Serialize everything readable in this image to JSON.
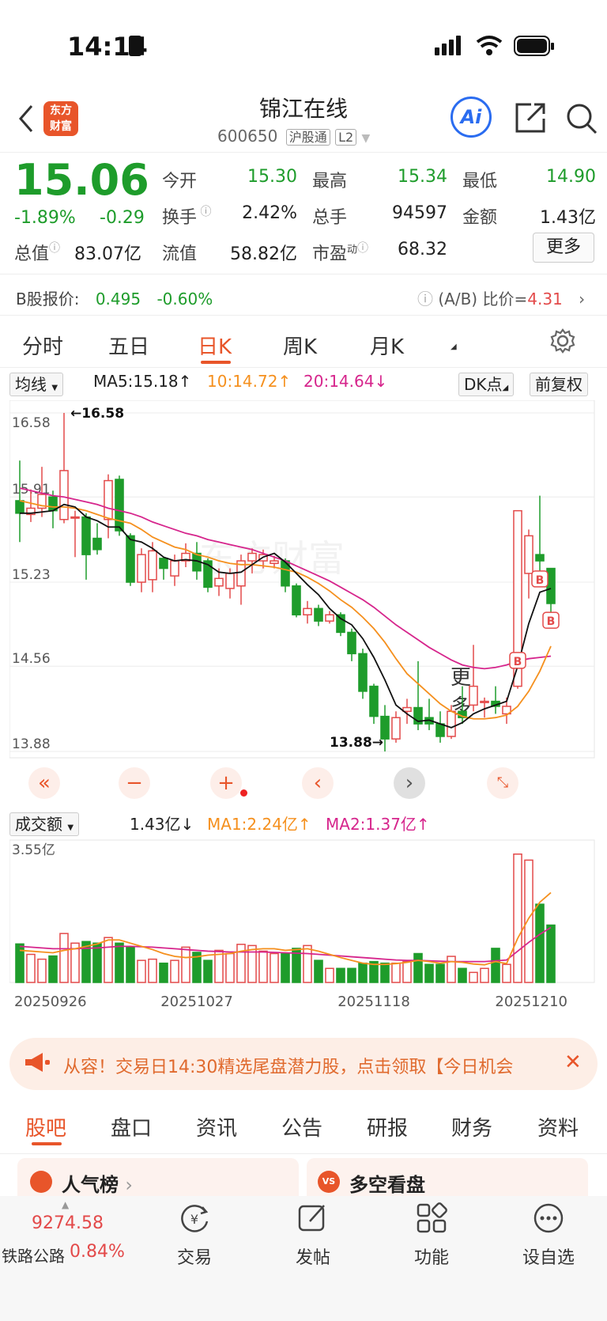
{
  "status": {
    "time": "14:14"
  },
  "header": {
    "logo_text": "东方财富",
    "name": "锦江在线",
    "code": "600650",
    "tag1": "沪股通",
    "tag2": "L2",
    "ai_label": "Ai"
  },
  "quote": {
    "price": "15.06",
    "change_pct": "-1.89%",
    "change_abs": "-0.29",
    "rows": [
      [
        {
          "label": "今开",
          "value": "15.30",
          "color": "green"
        },
        {
          "label": "最高",
          "value": "15.34",
          "color": "green"
        },
        {
          "label": "最低",
          "value": "14.90",
          "color": "green"
        }
      ],
      [
        {
          "label": "换手",
          "value": "2.42%",
          "color": "dark"
        },
        {
          "label": "总手",
          "value": "94597",
          "color": "dark"
        },
        {
          "label": "金额",
          "value": "1.43亿",
          "color": "dark"
        }
      ]
    ],
    "row3": {
      "label1": "总值",
      "value1": "83.07亿",
      "label2": "流值",
      "value2": "58.82亿",
      "label3": "市盈",
      "sup3": "动",
      "value3": "68.32"
    },
    "more_label": "更多"
  },
  "bquote": {
    "label": "B股报价:",
    "price": "0.495",
    "pct": "-0.60%",
    "ratio_label": "(A/B) 比价=",
    "ratio": "4.31"
  },
  "period_tabs": [
    "分时",
    "五日",
    "日K",
    "周K",
    "月K",
    "更多"
  ],
  "active_tab": "日K",
  "kline_legend": {
    "select": "均线",
    "ma5": "MA5:15.18↑",
    "ma10": "10:14.72↑",
    "ma20": "20:14.64↓",
    "dk": "DK点",
    "fq": "前复权"
  },
  "volume_legend": {
    "select": "成交额",
    "value": "1.43亿↓",
    "ma1": "MA1:2.24亿↑",
    "ma2": "MA2:1.37亿↑",
    "max_label": "3.55亿"
  },
  "banner_text": "从容！交易日14:30精选尾盘潜力股，点击领取【今日机会",
  "bottom_tabs": [
    "股吧",
    "盘口",
    "资讯",
    "公告",
    "研报",
    "财务",
    "资料"
  ],
  "active_bottom_tab": "股吧",
  "cards": {
    "left": "人气榜",
    "right": "多空看盘",
    "right_icon": "VS"
  },
  "bottom_nav": {
    "index_value": "9274.58",
    "index_name": "铁路公路",
    "index_pct": "0.84%",
    "items": [
      "交易",
      "发帖",
      "功能",
      "设自选"
    ]
  },
  "colors": {
    "up": "#e34a4a",
    "down": "#1e9c2b",
    "ma5": "#111111",
    "ma10": "#f5901e",
    "ma20": "#d6258c",
    "accent": "#e8552a"
  },
  "chart_data": {
    "type": "candlestick",
    "y_ticks": [
      "16.58",
      "15.91",
      "15.23",
      "14.56",
      "13.88"
    ],
    "ylim": [
      13.88,
      16.58
    ],
    "max_marker": "16.58",
    "min_marker": "13.88",
    "x_labels": [
      "20250926",
      "20251027",
      "20251118",
      "20251210"
    ],
    "candles": [
      {
        "o": 15.88,
        "c": 15.78,
        "h": 16.2,
        "l": 15.55
      },
      {
        "o": 15.77,
        "c": 15.82,
        "h": 15.97,
        "l": 15.71
      },
      {
        "o": 15.82,
        "c": 15.93,
        "h": 16.15,
        "l": 15.75
      },
      {
        "o": 15.91,
        "c": 15.8,
        "h": 15.96,
        "l": 15.66
      },
      {
        "o": 15.73,
        "c": 16.12,
        "h": 16.58,
        "l": 15.7
      },
      {
        "o": 15.75,
        "c": 15.75,
        "h": 15.8,
        "l": 15.43
      },
      {
        "o": 15.75,
        "c": 15.45,
        "h": 15.78,
        "l": 15.25
      },
      {
        "o": 15.58,
        "c": 15.49,
        "h": 15.7,
        "l": 15.45
      },
      {
        "o": 15.73,
        "c": 16.04,
        "h": 16.09,
        "l": 15.58
      },
      {
        "o": 16.05,
        "c": 15.64,
        "h": 16.08,
        "l": 15.6
      },
      {
        "o": 15.6,
        "c": 15.23,
        "h": 15.62,
        "l": 15.2
      },
      {
        "o": 15.23,
        "c": 15.45,
        "h": 15.5,
        "l": 15.15
      },
      {
        "o": 15.25,
        "c": 15.48,
        "h": 15.55,
        "l": 15.15
      },
      {
        "o": 15.42,
        "c": 15.34,
        "h": 15.43,
        "l": 15.25
      },
      {
        "o": 15.28,
        "c": 15.4,
        "h": 15.45,
        "l": 15.2
      },
      {
        "o": 15.4,
        "c": 15.46,
        "h": 15.54,
        "l": 15.35
      },
      {
        "o": 15.46,
        "c": 15.32,
        "h": 15.55,
        "l": 15.25
      },
      {
        "o": 15.4,
        "c": 15.19,
        "h": 15.42,
        "l": 15.15
      },
      {
        "o": 15.2,
        "c": 15.26,
        "h": 15.34,
        "l": 15.12
      },
      {
        "o": 15.18,
        "c": 15.3,
        "h": 15.34,
        "l": 15.1
      },
      {
        "o": 15.2,
        "c": 15.4,
        "h": 15.45,
        "l": 15.05
      },
      {
        "o": 15.4,
        "c": 15.46,
        "h": 15.5,
        "l": 15.3
      },
      {
        "o": 15.4,
        "c": 15.45,
        "h": 15.49,
        "l": 15.34
      },
      {
        "o": 15.38,
        "c": 15.4,
        "h": 15.44,
        "l": 15.34
      },
      {
        "o": 15.4,
        "c": 15.2,
        "h": 15.42,
        "l": 15.15
      },
      {
        "o": 15.2,
        "c": 14.97,
        "h": 15.22,
        "l": 14.95
      },
      {
        "o": 14.97,
        "c": 15.02,
        "h": 15.08,
        "l": 14.9
      },
      {
        "o": 15.02,
        "c": 14.92,
        "h": 15.05,
        "l": 14.88
      },
      {
        "o": 14.92,
        "c": 14.97,
        "h": 15.0,
        "l": 14.9
      },
      {
        "o": 14.97,
        "c": 14.83,
        "h": 14.99,
        "l": 14.8
      },
      {
        "o": 14.83,
        "c": 14.66,
        "h": 14.86,
        "l": 14.6
      },
      {
        "o": 14.66,
        "c": 14.36,
        "h": 14.7,
        "l": 14.3
      },
      {
        "o": 14.4,
        "c": 14.16,
        "h": 14.42,
        "l": 14.1
      },
      {
        "o": 14.16,
        "c": 13.98,
        "h": 14.25,
        "l": 13.88
      },
      {
        "o": 13.98,
        "c": 14.15,
        "h": 14.2,
        "l": 13.95
      },
      {
        "o": 14.2,
        "c": 14.23,
        "h": 14.3,
        "l": 14.1
      },
      {
        "o": 14.23,
        "c": 14.1,
        "h": 14.6,
        "l": 14.05
      },
      {
        "o": 14.15,
        "c": 14.1,
        "h": 14.3,
        "l": 14.05
      },
      {
        "o": 14.1,
        "c": 14.0,
        "h": 14.2,
        "l": 13.95
      },
      {
        "o": 14.0,
        "c": 14.2,
        "h": 14.25,
        "l": 13.98
      },
      {
        "o": 14.2,
        "c": 14.15,
        "h": 14.4,
        "l": 14.1
      },
      {
        "o": 14.25,
        "c": 14.4,
        "h": 14.73,
        "l": 14.2
      },
      {
        "o": 14.27,
        "c": 14.28,
        "h": 14.31,
        "l": 14.15
      },
      {
        "o": 14.28,
        "c": 14.24,
        "h": 14.4,
        "l": 14.18
      },
      {
        "o": 14.18,
        "c": 14.24,
        "h": 14.31,
        "l": 14.1
      },
      {
        "o": 14.4,
        "c": 15.8,
        "h": 15.8,
        "l": 14.38
      },
      {
        "o": 15.3,
        "c": 15.6,
        "h": 15.65,
        "l": 15.1
      },
      {
        "o": 15.45,
        "c": 15.4,
        "h": 15.92,
        "l": 15.2
      },
      {
        "o": 15.34,
        "c": 15.06,
        "h": 15.34,
        "l": 14.9
      }
    ],
    "ma5": [
      15.78,
      15.78,
      15.79,
      15.8,
      15.85,
      15.83,
      15.75,
      15.72,
      15.67,
      15.67,
      15.57,
      15.55,
      15.5,
      15.43,
      15.4,
      15.41,
      15.4,
      15.37,
      15.31,
      15.3,
      15.31,
      15.37,
      15.43,
      15.46,
      15.39,
      15.3,
      15.21,
      15.13,
      15.02,
      14.94,
      14.89,
      14.78,
      14.63,
      14.45,
      14.25,
      14.18,
      14.12,
      14.13,
      14.1,
      14.07,
      14.11,
      14.18,
      14.22,
      14.25,
      14.28,
      14.56,
      14.9,
      15.15,
      15.18
    ],
    "ma10": [
      15.88,
      15.86,
      15.84,
      15.83,
      15.83,
      15.82,
      15.8,
      15.77,
      15.74,
      15.72,
      15.7,
      15.65,
      15.59,
      15.55,
      15.51,
      15.49,
      15.45,
      15.43,
      15.4,
      15.38,
      15.37,
      15.37,
      15.36,
      15.35,
      15.33,
      15.31,
      15.27,
      15.22,
      15.16,
      15.09,
      15.03,
      14.95,
      14.86,
      14.75,
      14.62,
      14.5,
      14.42,
      14.34,
      14.26,
      14.2,
      14.16,
      14.14,
      14.14,
      14.15,
      14.17,
      14.24,
      14.36,
      14.52,
      14.72
    ],
    "ma20": [
      15.98,
      15.96,
      15.94,
      15.92,
      15.91,
      15.89,
      15.87,
      15.85,
      15.82,
      15.8,
      15.78,
      15.75,
      15.71,
      15.68,
      15.65,
      15.62,
      15.6,
      15.57,
      15.55,
      15.53,
      15.51,
      15.49,
      15.46,
      15.43,
      15.4,
      15.36,
      15.32,
      15.28,
      15.24,
      15.19,
      15.14,
      15.09,
      15.03,
      14.96,
      14.89,
      14.83,
      14.77,
      14.71,
      14.66,
      14.61,
      14.57,
      14.55,
      14.54,
      14.55,
      14.57,
      14.6,
      14.62,
      14.63,
      14.64
    ],
    "volumes": [
      0.96,
      0.7,
      0.58,
      0.66,
      1.22,
      0.98,
      1.02,
      0.98,
      1.12,
      0.98,
      0.88,
      0.55,
      0.58,
      0.48,
      0.55,
      0.88,
      0.75,
      0.55,
      0.8,
      0.72,
      0.95,
      0.92,
      0.78,
      0.72,
      0.72,
      0.85,
      0.92,
      0.55,
      0.35,
      0.35,
      0.35,
      0.48,
      0.52,
      0.48,
      0.48,
      0.52,
      0.72,
      0.45,
      0.45,
      0.65,
      0.35,
      0.25,
      0.35,
      0.85,
      0.45,
      3.2,
      3.05,
      1.95,
      1.43
    ],
    "vol_ma1": [
      0.8,
      0.78,
      0.76,
      0.74,
      0.8,
      0.84,
      0.9,
      0.96,
      1.06,
      1.06,
      0.98,
      0.9,
      0.82,
      0.72,
      0.65,
      0.62,
      0.64,
      0.68,
      0.7,
      0.72,
      0.78,
      0.82,
      0.84,
      0.84,
      0.8,
      0.82,
      0.84,
      0.78,
      0.7,
      0.62,
      0.55,
      0.48,
      0.45,
      0.45,
      0.47,
      0.5,
      0.55,
      0.52,
      0.48,
      0.52,
      0.5,
      0.46,
      0.44,
      0.52,
      0.47,
      1.1,
      1.6,
      2.0,
      2.24
    ],
    "vol_ma2": [
      0.9,
      0.88,
      0.86,
      0.84,
      0.84,
      0.84,
      0.85,
      0.86,
      0.88,
      0.9,
      0.9,
      0.89,
      0.88,
      0.86,
      0.84,
      0.82,
      0.8,
      0.78,
      0.77,
      0.76,
      0.76,
      0.76,
      0.76,
      0.75,
      0.74,
      0.73,
      0.72,
      0.7,
      0.68,
      0.66,
      0.64,
      0.62,
      0.6,
      0.58,
      0.56,
      0.55,
      0.55,
      0.54,
      0.53,
      0.52,
      0.52,
      0.52,
      0.52,
      0.54,
      0.56,
      0.78,
      1.0,
      1.2,
      1.37
    ],
    "vol_max": 3.55
  }
}
